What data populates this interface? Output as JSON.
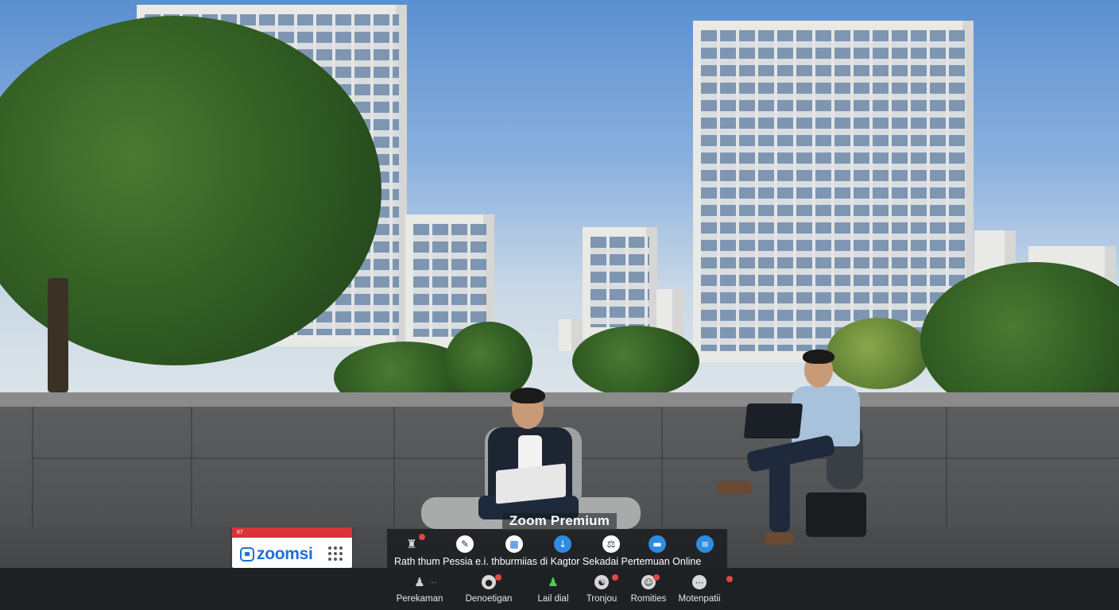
{
  "meeting": {
    "title": "Zoom Premium"
  },
  "branding": {
    "logo_text": "zoomsi",
    "strip_text": "87",
    "accent_color": "#1f6fd6",
    "strip_color": "#d9333a"
  },
  "toolbar_top": {
    "caption": "Rath thum   Pessia  e.i. thburmiias  di Kagtor  Sekadai  Pertemuan Online",
    "items": [
      {
        "icon": "participants-icon",
        "has_badge": true
      },
      {
        "icon": "edit-icon",
        "has_badge": false
      },
      {
        "icon": "screen-share-icon",
        "has_badge": false
      },
      {
        "icon": "info-icon",
        "has_badge": false
      },
      {
        "icon": "balance-icon",
        "has_badge": false
      },
      {
        "icon": "chat-icon",
        "has_badge": false
      },
      {
        "icon": "menu-icon",
        "has_badge": false
      }
    ]
  },
  "toolbar_bottom": {
    "items": [
      {
        "label": "Perekaman",
        "icon": "people-icon",
        "has_badge": false
      },
      {
        "label": "Denoetigan",
        "icon": "recording-icon",
        "has_badge": true
      },
      {
        "label": "Lail dial",
        "icon": "participants-green-icon",
        "has_badge": false
      },
      {
        "label": "Tronjou",
        "icon": "cart-icon",
        "has_badge": true
      },
      {
        "label": "Romities",
        "icon": "reactions-icon",
        "has_badge": true
      },
      {
        "label": "Motenpatii",
        "icon": "more-icon",
        "has_badge": true
      }
    ]
  },
  "colors": {
    "toolbar_bg": "#1e2124",
    "badge_red": "#e64545",
    "title_underline": "#6ad06a"
  }
}
